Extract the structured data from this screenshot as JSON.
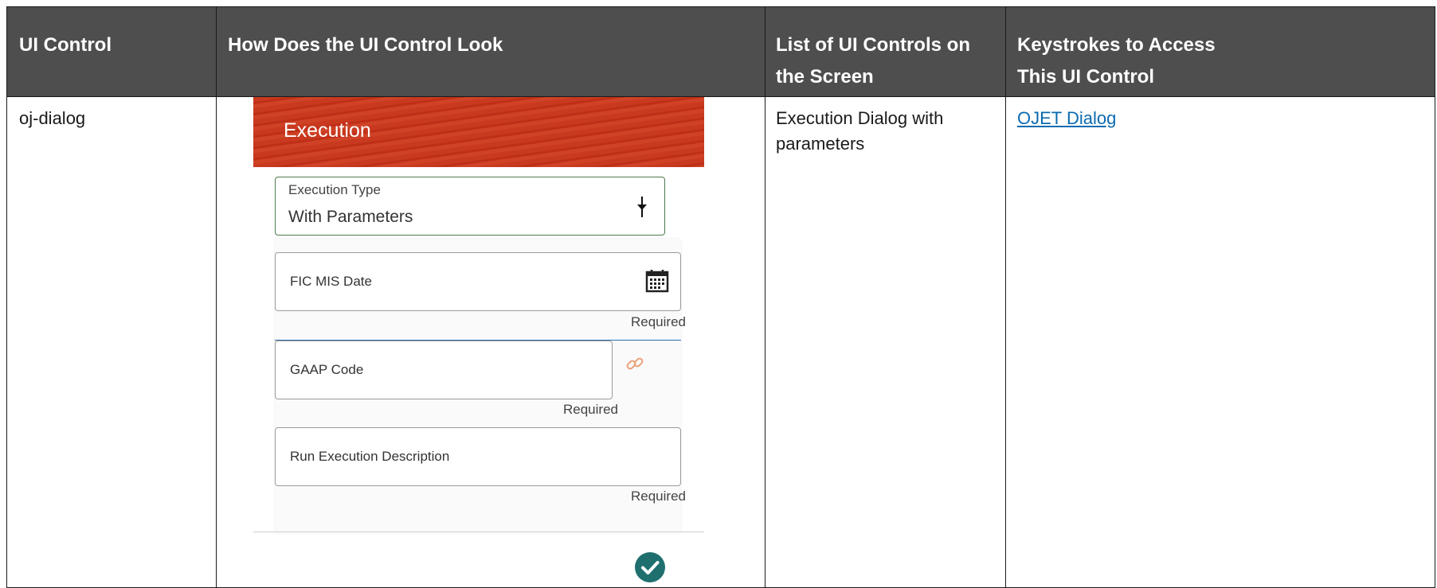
{
  "headers": {
    "ui_control": "UI Control",
    "how_look": "How Does the UI Control Look",
    "list_controls": "List of UI Controls on the Screen",
    "keystrokes": "Keystrokes to Access This UI Control"
  },
  "row": {
    "ui_control": "oj-dialog",
    "list_controls": "Execution Dialog with parameters",
    "keystrokes_link": "OJET Dialog"
  },
  "dialog": {
    "title": "Execution",
    "execution_type_label": "Execution Type",
    "execution_type_value": "With Parameters",
    "fields": [
      {
        "label": "FIC MIS Date",
        "hint": "Required"
      },
      {
        "label": "GAAP Code",
        "hint": "Required"
      },
      {
        "label": "Run Execution Description",
        "hint": "Required"
      }
    ]
  },
  "colors": {
    "header_bg": "#4e4e4e",
    "dialog_header": "#c9391f",
    "link": "#0b6ab0",
    "check": "#1f6f6f"
  },
  "icons": [
    "pin-icon",
    "calendar-icon",
    "link-icon",
    "check-circle-icon"
  ]
}
